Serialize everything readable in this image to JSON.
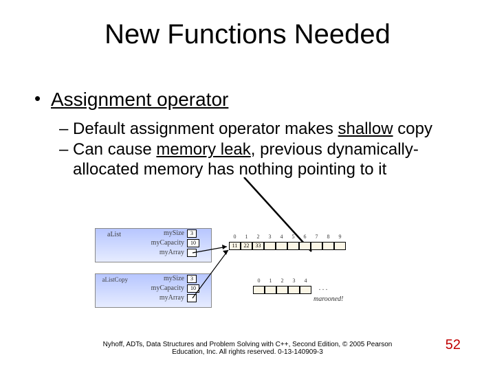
{
  "title": "New Functions Needed",
  "bullet_main": "Assignment operator",
  "sub1_pre": "Default assignment operator makes ",
  "sub1_u": "shallow",
  "sub1_post": " copy",
  "sub2_pre": "Can cause ",
  "sub2_u": "memory leak",
  "sub2_post": ", previous dynamically-allocated memory has nothing pointing to it",
  "diagram": {
    "obj1": "aList",
    "obj2": "aListCopy",
    "f_mySize": "mySize",
    "f_myCapacity": "myCapacity",
    "f_myArray": "myArray",
    "v_mySize1": "3",
    "v_myCapacity1": "10",
    "v_mySize2": "3",
    "v_myCapacity2": "10",
    "idx_top": [
      "0",
      "1",
      "2",
      "3",
      "4",
      "5",
      "6",
      "7",
      "8",
      "9"
    ],
    "cells_top": [
      "11",
      "22",
      "33",
      "",
      "",
      "",
      "",
      "",
      "",
      ""
    ],
    "idx_bot": [
      "0",
      "1",
      "2",
      "3",
      "4"
    ],
    "cells_bot": [
      "",
      "",
      "",
      "",
      ""
    ],
    "dots": ". . .",
    "marooned": "marooned!"
  },
  "footer_l1": "Nyhoff, ADTs, Data Structures and Problem Solving with C++, Second Edition, © 2005 Pearson",
  "footer_l2": "Education, Inc. All rights reserved. 0-13-140909-3",
  "page": "52"
}
